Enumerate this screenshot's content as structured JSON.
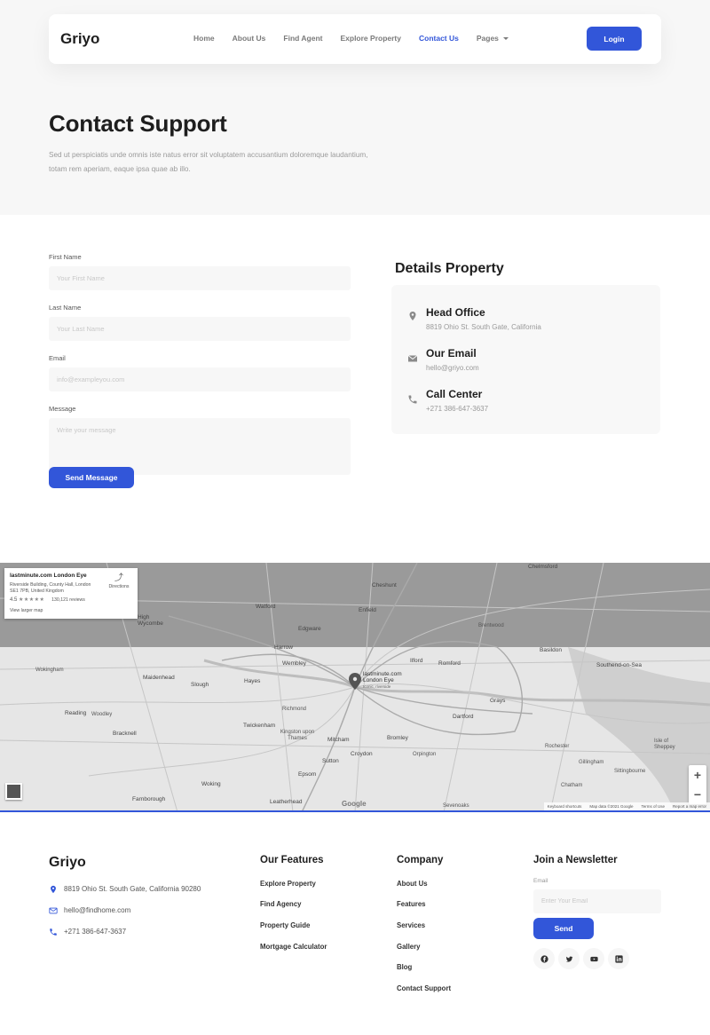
{
  "nav": {
    "brand": "Griyo",
    "links": [
      "Home",
      "About Us",
      "Find Agent",
      "Explore Property",
      "Contact Us",
      "Pages"
    ],
    "login": "Login"
  },
  "hero": {
    "title": "Contact Support",
    "subtitle": "Sed ut perspiciatis unde omnis iste natus error sit voluptatem accusantium doloremque laudantium, totam rem aperiam, eaque ipsa quae ab illo."
  },
  "form": {
    "first_name_label": "First Name",
    "first_name_placeholder": "Your First Name",
    "last_name_label": "Last Name",
    "last_name_placeholder": "Your Last Name",
    "email_label": "Email",
    "email_placeholder": "info@exampleyou.com",
    "message_label": "Message",
    "message_placeholder": "Write your message",
    "submit": "Send Message"
  },
  "details": {
    "title": "Details Property",
    "items": [
      {
        "title": "Head Office",
        "text": "8819 Ohio St. South Gate, California"
      },
      {
        "title": "Our Email",
        "text": "hello@griyo.com"
      },
      {
        "title": "Call Center",
        "text": "+271 386-647-3637"
      }
    ]
  },
  "map": {
    "place_title": "lastminute.com London Eye",
    "place_address": "Riverside Building, County Hall, London SE1 7PB, United Kingdom",
    "rating": "4.5",
    "stars": "★★★★★",
    "reviews": "130,121 reviews",
    "larger_map": "View larger map",
    "directions": "Directions",
    "pin_label_1": "lastminute.com",
    "pin_label_2": "London Eye",
    "pin_label_3": "Iconic, riverside",
    "google": "Google",
    "zoom_in": "+",
    "zoom_out": "−",
    "attribution": [
      "Keyboard shortcuts",
      "Map data ©2021 Google",
      "Terms of Use",
      "Report a map error"
    ],
    "places": [
      "Chelmsford",
      "Watford",
      "Cheshunt",
      "Enfield",
      "Edgware",
      "High Wycombe",
      "Harrow",
      "Wembley",
      "Romford",
      "Basildon",
      "Southend-on-Sea",
      "Maidenhead",
      "Slough",
      "Hayes",
      "Ilford",
      "Grays",
      "Reading",
      "Woodley",
      "Twickenham",
      "Richmond",
      "Dartford",
      "Bracknell",
      "Kingston upon Thames",
      "Mitcham",
      "Bromley",
      "Croydon",
      "Sutton",
      "Epsom",
      "Woking",
      "Farnborough",
      "Leatherhead",
      "Orpington",
      "Chatham",
      "Sevenoaks",
      "Brentwood",
      "Isle of Sheppey",
      "Rochester",
      "Gillingham",
      "Wokingham",
      "Sittingbourne"
    ]
  },
  "footer": {
    "brand": "Griyo",
    "address": "8819 Ohio St. South Gate, California 90280",
    "email": "hello@findhome.com",
    "phone": "+271 386-647-3637",
    "features_title": "Our Features",
    "features": [
      "Explore Property",
      "Find Agency",
      "Property Guide",
      "Mortgage Calculator"
    ],
    "company_title": "Company",
    "company": [
      "About Us",
      "Features",
      "Services",
      "Gallery",
      "Blog",
      "Contact Support"
    ],
    "newsletter_title": "Join a Newsletter",
    "newsletter_label": "Email",
    "newsletter_placeholder": "Enter Your Email",
    "newsletter_button": "Send"
  },
  "colors": {
    "accent": "#3256d9",
    "heading": "#1e1e1e",
    "muted": "#999999",
    "hero_bg": "#f7f7f7"
  },
  "icons": {
    "head_office": "map-pin-icon",
    "email": "envelope-icon",
    "call": "phone-icon",
    "socials": [
      "facebook-icon",
      "twitter-icon",
      "youtube-icon",
      "linkedin-icon"
    ]
  }
}
